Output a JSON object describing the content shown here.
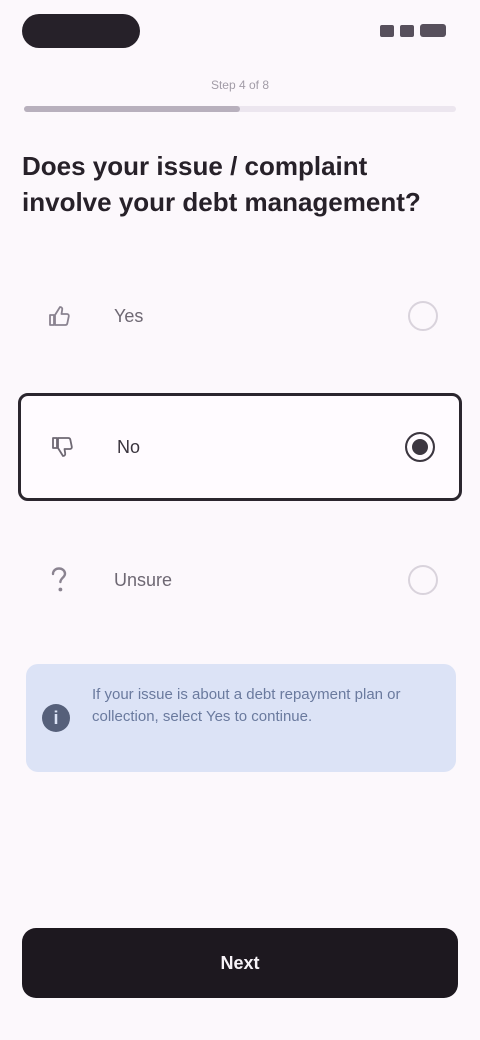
{
  "step": {
    "label": "Step 4 of 8",
    "progress": 0.5
  },
  "question": "Does your issue / complaint involve your debt management?",
  "options": [
    {
      "label": "Yes",
      "icon": "thumbs-up-icon",
      "selected": false
    },
    {
      "label": "No",
      "icon": "thumbs-down-icon",
      "selected": true
    },
    {
      "label": "Unsure",
      "icon": "question-mark-icon",
      "selected": false
    }
  ],
  "info": {
    "icon": "info-icon",
    "text": "If your issue is about a debt repayment plan or collection, select Yes to continue."
  },
  "primary_button": {
    "label": "Next"
  },
  "colors": {
    "background": "#fcf8fc",
    "button": "#1d181f",
    "info_background": "#dce3f6"
  }
}
